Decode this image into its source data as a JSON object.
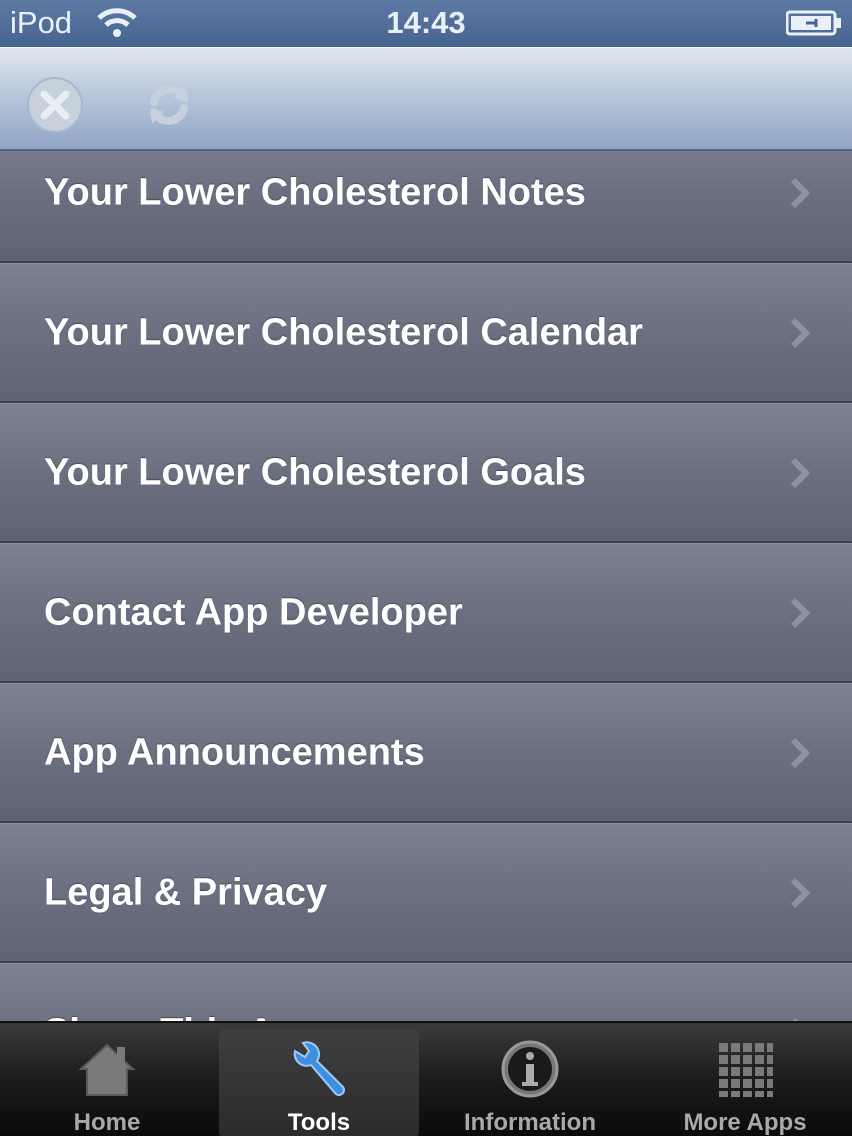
{
  "status_bar": {
    "carrier": "iPod",
    "time": "14:43"
  },
  "toolbar": {
    "close_icon": "close-icon",
    "refresh_icon": "refresh-icon"
  },
  "menu": {
    "items": [
      {
        "label": "Your Lower Cholesterol Notes"
      },
      {
        "label": "Your Lower Cholesterol Calendar"
      },
      {
        "label": "Your Lower Cholesterol Goals"
      },
      {
        "label": "Contact App Developer"
      },
      {
        "label": "App Announcements"
      },
      {
        "label": "Legal & Privacy"
      },
      {
        "label": "Share This App"
      }
    ]
  },
  "tabs": [
    {
      "label": "Home",
      "icon": "home-icon",
      "active": false
    },
    {
      "label": "Tools",
      "icon": "wrench-icon",
      "active": true
    },
    {
      "label": "Information",
      "icon": "info-icon",
      "active": false
    },
    {
      "label": "More Apps",
      "icon": "grid-icon",
      "active": false
    }
  ],
  "colors": {
    "active_tab_icon": "#3d8fe0",
    "list_text": "#ffffff",
    "toolbar": "#b9c7dc"
  }
}
